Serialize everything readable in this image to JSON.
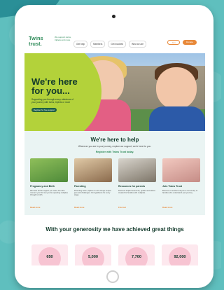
{
  "header": {
    "logo_text": "Twins trust.",
    "tagline": "We support twins, triplets and more",
    "nav": [
      "Get help",
      "Members",
      "Get involved",
      "Who we are"
    ],
    "join_label": "Join",
    "donate_label": "Donate"
  },
  "hero": {
    "title": "We're here for you...",
    "subtitle": "Supporting you through every milestone of your journey with twins, triplets or more",
    "button": "Register for free support"
  },
  "help": {
    "title": "We're here to help",
    "subtitle": "Wherever you are in your journey, explore our support, we're here for you.",
    "link": "Register with Twins Trust today.",
    "cards": [
      {
        "title": "Pregnancy and Birth",
        "text": "We have all the support you need, from the moment you find out you're expecting multiples through to birth.",
        "link": "Read more"
      },
      {
        "title": "Parenting",
        "text": "Parenting twins, triplets or more brings unique joys and challenges. Find guidance for every stage.",
        "link": "Read more"
      },
      {
        "title": "Resources for parents",
        "text": "Discover helpful resources, guides and advice created for families with multiples.",
        "link": "Find out"
      },
      {
        "title": "Join Twins Trust",
        "text": "Become a member and join a community of families who understand your journey.",
        "link": "Read more"
      }
    ]
  },
  "generosity": {
    "title": "With your generosity we have achieved great things",
    "stats": [
      "650",
      "5,000",
      "7,700",
      "92,000"
    ]
  },
  "colors": {
    "brand_green": "#2d8a58",
    "hero_lime": "#b3d23a",
    "accent_orange": "#e8893a",
    "page_teal": "#5fbfbe"
  }
}
